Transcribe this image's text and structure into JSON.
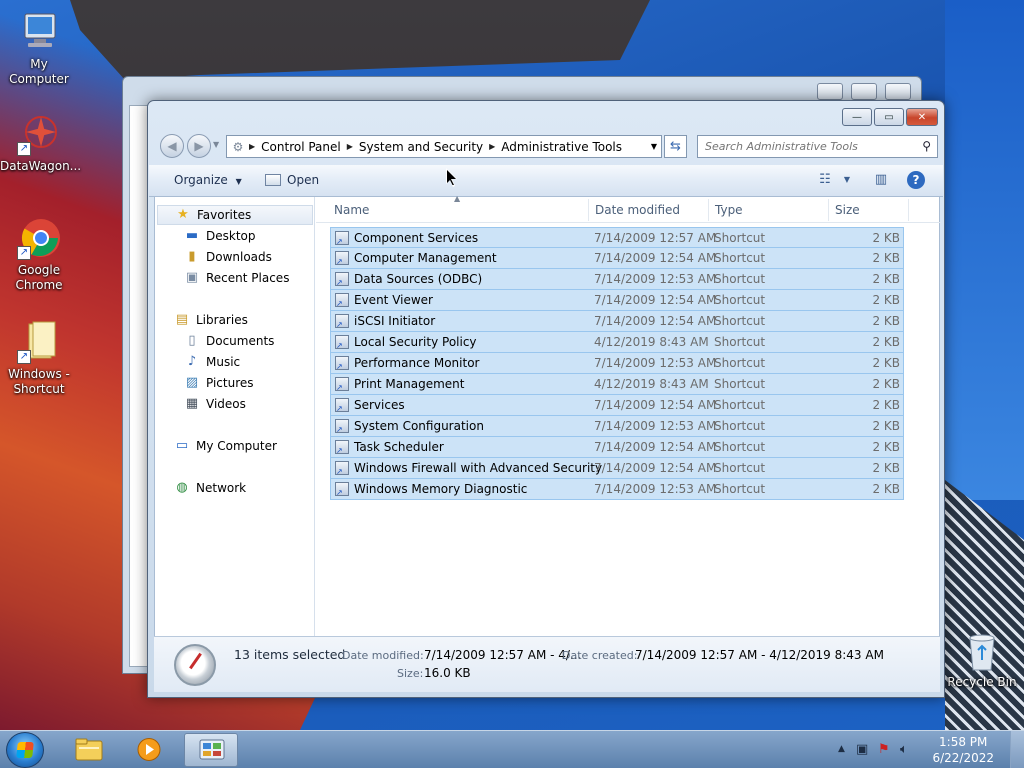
{
  "desktop": {
    "icons": [
      {
        "label": "My Computer",
        "icon": "computer-icon"
      },
      {
        "label": "DataWagon...",
        "icon": "datawagon-icon"
      },
      {
        "label": "Google Chrome",
        "icon": "chrome-icon"
      },
      {
        "label": "Windows - Shortcut",
        "icon": "folder-icon"
      },
      {
        "label": "Recycle Bin",
        "icon": "recycle-bin-icon"
      }
    ]
  },
  "window": {
    "controls": {
      "minimize": "—",
      "maximize": "▭",
      "close": "✕"
    },
    "address": {
      "crumbs": [
        "Control Panel",
        "System and Security",
        "Administrative Tools"
      ]
    },
    "search": {
      "placeholder": "Search Administrative Tools"
    },
    "toolbar": {
      "organize": "Organize",
      "open": "Open"
    },
    "nav": {
      "favorites": "Favorites",
      "desktop": "Desktop",
      "downloads": "Downloads",
      "recent_places": "Recent Places",
      "libraries": "Libraries",
      "documents": "Documents",
      "music": "Music",
      "pictures": "Pictures",
      "videos": "Videos",
      "my_computer": "My Computer",
      "network": "Network"
    },
    "columns": {
      "name": "Name",
      "date": "Date modified",
      "type": "Type",
      "size": "Size"
    },
    "files": [
      {
        "name": "Component Services",
        "date": "7/14/2009 12:57 AM",
        "type": "Shortcut",
        "size": "2 KB"
      },
      {
        "name": "Computer Management",
        "date": "7/14/2009 12:54 AM",
        "type": "Shortcut",
        "size": "2 KB"
      },
      {
        "name": "Data Sources (ODBC)",
        "date": "7/14/2009 12:53 AM",
        "type": "Shortcut",
        "size": "2 KB"
      },
      {
        "name": "Event Viewer",
        "date": "7/14/2009 12:54 AM",
        "type": "Shortcut",
        "size": "2 KB"
      },
      {
        "name": "iSCSI Initiator",
        "date": "7/14/2009 12:54 AM",
        "type": "Shortcut",
        "size": "2 KB"
      },
      {
        "name": "Local Security Policy",
        "date": "4/12/2019 8:43 AM",
        "type": "Shortcut",
        "size": "2 KB"
      },
      {
        "name": "Performance Monitor",
        "date": "7/14/2009 12:53 AM",
        "type": "Shortcut",
        "size": "2 KB"
      },
      {
        "name": "Print Management",
        "date": "4/12/2019 8:43 AM",
        "type": "Shortcut",
        "size": "2 KB"
      },
      {
        "name": "Services",
        "date": "7/14/2009 12:54 AM",
        "type": "Shortcut",
        "size": "2 KB"
      },
      {
        "name": "System Configuration",
        "date": "7/14/2009 12:53 AM",
        "type": "Shortcut",
        "size": "2 KB"
      },
      {
        "name": "Task Scheduler",
        "date": "7/14/2009 12:54 AM",
        "type": "Shortcut",
        "size": "2 KB"
      },
      {
        "name": "Windows Firewall with Advanced Security",
        "date": "7/14/2009 12:54 AM",
        "type": "Shortcut",
        "size": "2 KB"
      },
      {
        "name": "Windows Memory Diagnostic",
        "date": "7/14/2009 12:53 AM",
        "type": "Shortcut",
        "size": "2 KB"
      }
    ],
    "details": {
      "count": "13 items selected",
      "date_modified_label": "Date modified:",
      "date_modified_value": "7/14/2009 12:57 AM - 4/...",
      "date_created_label": "Date created:",
      "date_created_value": "7/14/2009 12:57 AM - 4/12/2019 8:43 AM",
      "size_label": "Size:",
      "size_value": "16.0 KB"
    }
  },
  "taskbar": {
    "time": "1:58 PM",
    "date": "6/22/2022"
  },
  "colors": {
    "selection": "#cce3f7",
    "selection_border": "#99c6ee",
    "taskbar": "#6f91b9"
  }
}
